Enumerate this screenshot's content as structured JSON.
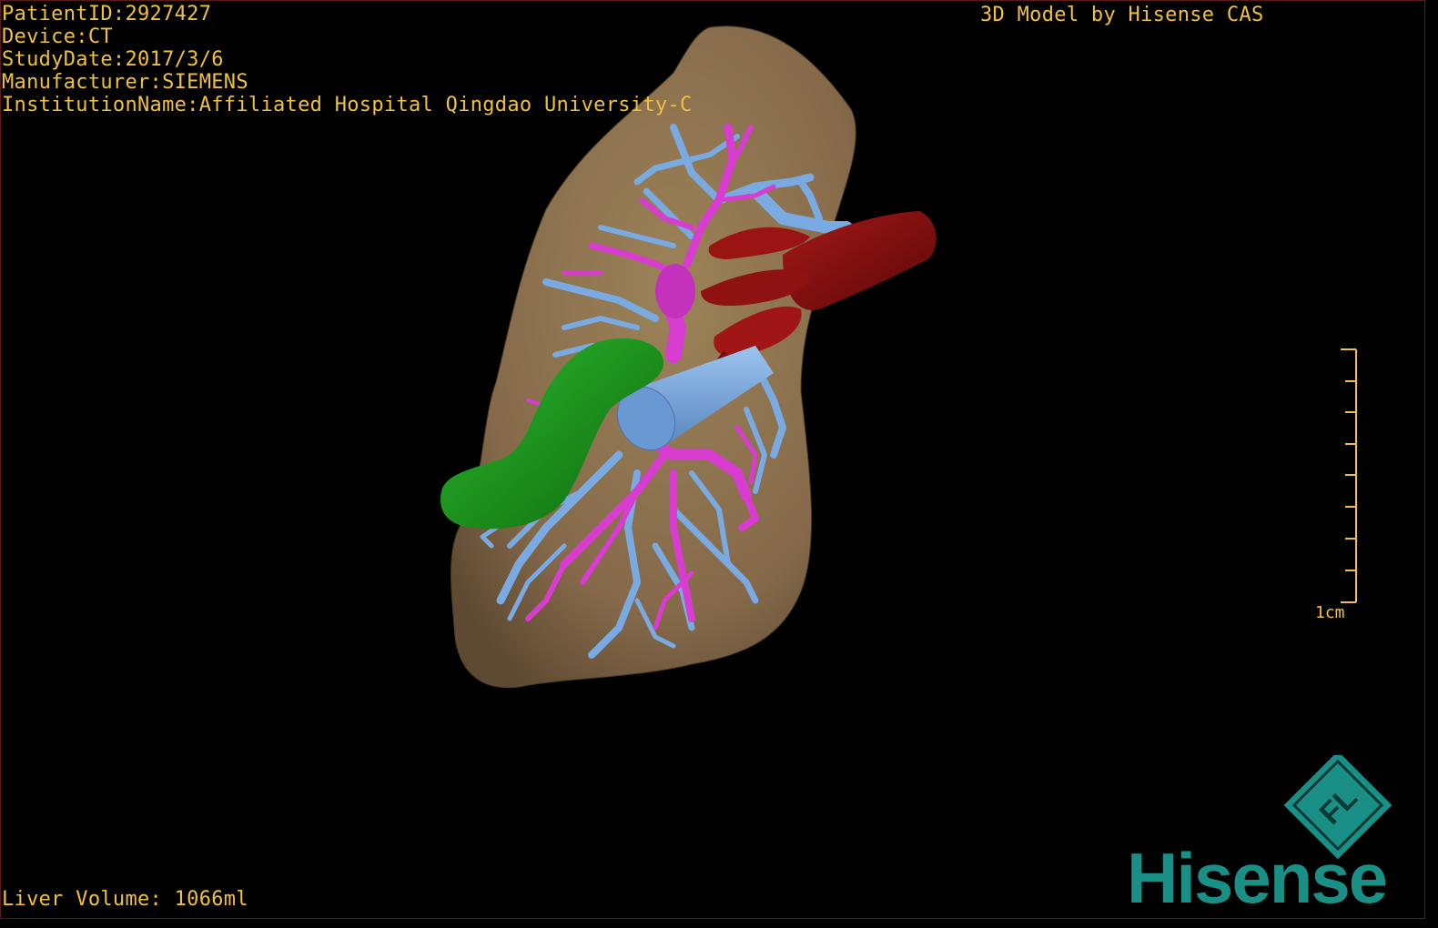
{
  "header": {
    "patient_id": "PatientID:2927427",
    "device": "Device:CT",
    "study_date": "StudyDate:2017/3/6",
    "manufacturer": "Manufacturer:SIEMENS",
    "institution": "InstitutionName:Affiliated Hospital Qingdao University-C"
  },
  "credit": "3D Model by Hisense CAS",
  "footer": {
    "liver_volume": "Liver Volume: 1066ml"
  },
  "scale": {
    "label": "1cm"
  },
  "brand": {
    "wordmark": "Hisense",
    "badge_letters": "FL",
    "color": "#1a8f86"
  },
  "model": {
    "liver_color": "#8c7350",
    "portal_vein_color": "#78a8e0",
    "hepatic_artery_color": "#d83cd0",
    "ivc_color": "#8a1010",
    "gallbladder_color": "#1e9a1e"
  }
}
